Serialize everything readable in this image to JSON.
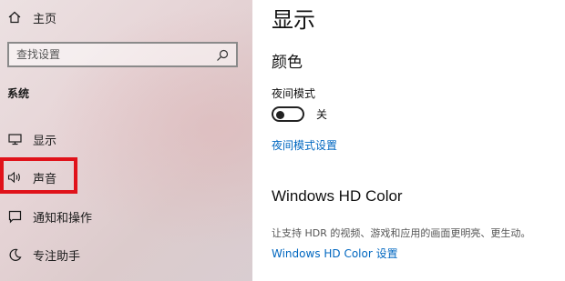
{
  "sidebar": {
    "home_label": "主页",
    "search_placeholder": "查找设置",
    "section_label": "系统",
    "items": [
      {
        "label": "显示",
        "icon": "monitor-icon"
      },
      {
        "label": "声音",
        "icon": "speaker-icon"
      },
      {
        "label": "通知和操作",
        "icon": "notification-icon"
      },
      {
        "label": "专注助手",
        "icon": "moon-icon"
      }
    ]
  },
  "main": {
    "title": "显示",
    "color_heading": "颜色",
    "night_mode_label": "夜间模式",
    "night_mode_state": "关",
    "night_mode_on": false,
    "night_mode_settings_link": "夜间模式设置",
    "hd_color_heading": "Windows HD Color",
    "hd_color_description": "让支持 HDR 的视频、游戏和应用的画面更明亮、更生动。",
    "hd_color_settings_link": "Windows HD Color 设置"
  },
  "colors": {
    "link": "#0067c0",
    "highlight": "#e0121a"
  }
}
